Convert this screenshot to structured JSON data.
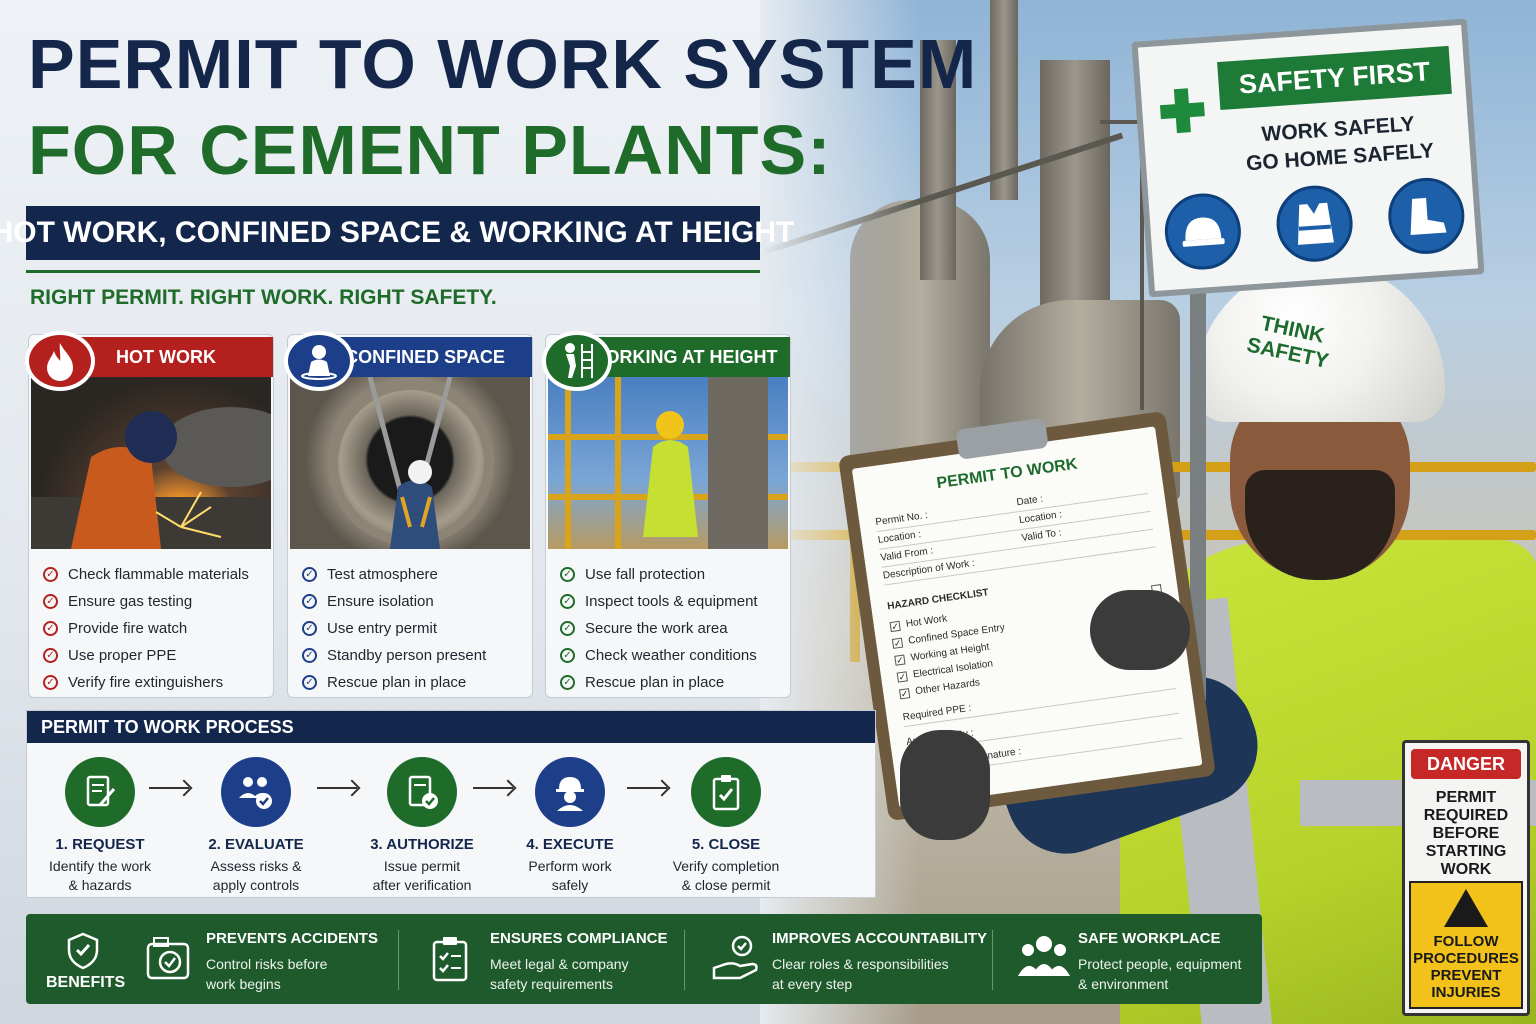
{
  "title": {
    "line1": "PERMIT TO WORK SYSTEM",
    "line2": "FOR CEMENT PLANTS:",
    "subtitle": "HOT WORK, CONFINED SPACE & WORKING AT HEIGHT",
    "tagline": "RIGHT PERMIT. RIGHT WORK. RIGHT SAFETY."
  },
  "colors": {
    "navy": "#13264c",
    "green": "#1f6b2a",
    "red": "#b3201e",
    "blue": "#1d3f8a"
  },
  "cards": [
    {
      "label": "HOT WORK",
      "icon": "fire-icon",
      "color": "#b3201e",
      "items": [
        "Check flammable materials",
        "Ensure gas testing",
        "Provide fire watch",
        "Use proper PPE",
        "Verify fire extinguishers"
      ]
    },
    {
      "label": "CONFINED SPACE",
      "icon": "worker-in-manhole-icon",
      "color": "#1d3f8a",
      "items": [
        "Test atmosphere",
        "Ensure isolation",
        "Use entry permit",
        "Standby person present",
        "Rescue plan in place"
      ]
    },
    {
      "label": "WORKING AT HEIGHT",
      "icon": "ladder-worker-icon",
      "color": "#1f6b2a",
      "items": [
        "Use fall protection",
        "Inspect tools & equipment",
        "Secure the work area",
        "Check weather conditions",
        "Rescue plan in place"
      ]
    }
  ],
  "process": {
    "title": "PERMIT TO WORK PROCESS",
    "steps": [
      {
        "name": "1. REQUEST",
        "desc_line1": "Identify the work",
        "desc_line2": "& hazards",
        "icon": "document-pen-icon"
      },
      {
        "name": "2. EVALUATE",
        "desc_line1": "Assess risks &",
        "desc_line2": "apply controls",
        "icon": "team-check-icon"
      },
      {
        "name": "3. AUTHORIZE",
        "desc_line1": "Issue permit",
        "desc_line2": "after verification",
        "icon": "document-check-icon"
      },
      {
        "name": "4. EXECUTE",
        "desc_line1": "Perform work",
        "desc_line2": "safely",
        "icon": "hard-hat-worker-icon"
      },
      {
        "name": "5. CLOSE",
        "desc_line1": "Verify completion",
        "desc_line2": "& close permit",
        "icon": "clipboard-check-icon"
      }
    ]
  },
  "benefits": {
    "label": "BENEFITS",
    "items": [
      {
        "title": "PREVENTS ACCIDENTS",
        "desc_line1": "Control risks before",
        "desc_line2": "work begins",
        "icon": "camera-shield-icon"
      },
      {
        "title": "ENSURES COMPLIANCE",
        "desc_line1": "Meet legal & company",
        "desc_line2": "safety requirements",
        "icon": "clipboard-check-icon"
      },
      {
        "title": "IMPROVES ACCOUNTABILITY",
        "desc_line1": "Clear roles & responsibilities",
        "desc_line2": "at every step",
        "icon": "hand-check-icon"
      },
      {
        "title": "SAFE WORKPLACE",
        "desc_line1": "Protect people, equipment",
        "desc_line2": "& environment",
        "icon": "people-group-icon"
      }
    ]
  },
  "sign": {
    "banner": "SAFETY FIRST",
    "line1": "WORK SAFELY",
    "line2": "GO HOME SAFELY",
    "ppe_icons": [
      "hard-hat-icon",
      "safety-vest-icon",
      "safety-boot-icon"
    ]
  },
  "helmet_text": "THINK SAFETY",
  "permit_form": {
    "title": "PERMIT TO WORK",
    "permit_no": "Permit No. :",
    "date": "Date :",
    "location1": "Location :",
    "location2": "Location :",
    "valid_from": "Valid From :",
    "valid_to": "Valid To :",
    "description": "Description of Work :",
    "checklist_title": "HAZARD CHECKLIST",
    "checklist": [
      "Hot Work",
      "Confined Space Entry",
      "Working at Height",
      "Electrical Isolation",
      "Other Hazards"
    ],
    "required_ppe": "Required PPE :",
    "authorised_by": "Authorised By :",
    "holder_signature": "Permit Holder Signature :"
  },
  "danger_sign": {
    "header": "DANGER",
    "text": "PERMIT REQUIRED BEFORE STARTING WORK",
    "caution": "FOLLOW PROCEDURES PREVENT INJURIES"
  }
}
